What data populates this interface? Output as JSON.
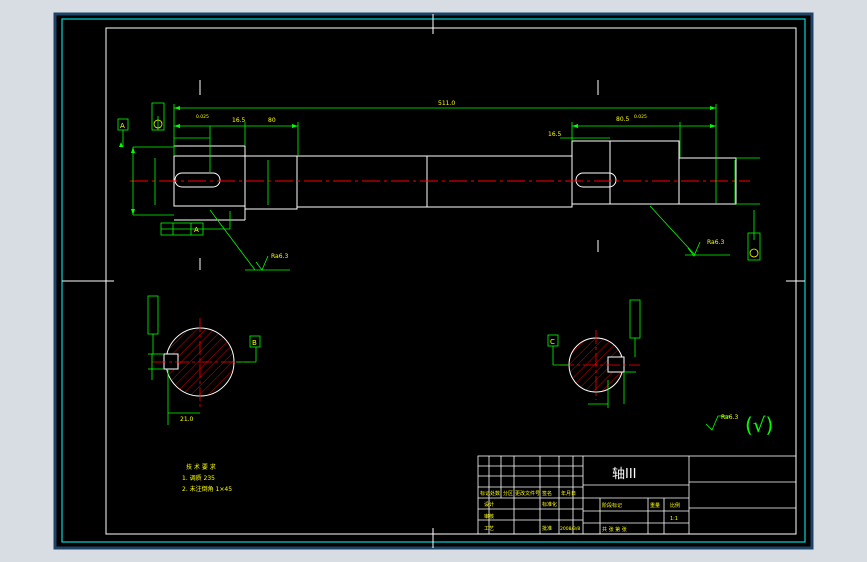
{
  "drawing": {
    "title": "轴III",
    "overall_length": "511.0",
    "technical_requirements": {
      "heading": "技 术 要 求",
      "item_1": "1. 调质 235",
      "item_2": "2. 未注倒角 1×45"
    },
    "general_roughness": "Ra6.3",
    "datum_letters": {
      "a": "A",
      "b": "B",
      "c": "C"
    },
    "dims": {
      "left_keyway": "80",
      "left_step": "16.5",
      "left_dia": "φ",
      "right_keyway": "16.5",
      "right_len": "80.5",
      "key_width": "21.0",
      "tolerance": "0.025"
    },
    "roughness_marks": {
      "left": "Ra6.3",
      "right": "Ra6.3"
    }
  },
  "title_block": {
    "name": "轴III",
    "row_labels": [
      "标记",
      "处数",
      "分区",
      "更改文件号",
      "签名",
      "年月日"
    ],
    "designer": "设计",
    "reviewer": "审核",
    "process": "工艺",
    "standard": "标准化",
    "approve": "批准",
    "date": "2008/3/8",
    "stage_label": "阶段标记",
    "weight": "重量",
    "scale": "比例",
    "scale_value": "1:1",
    "sheet": "共 张 第 张"
  },
  "colors": {
    "frame": "#00ffff",
    "outline": "#ffffff",
    "dimension": "#00ff00",
    "text": "#ffff00",
    "centerline": "#ff0000",
    "hatch": "#ff0000",
    "paper": "#000000",
    "border_bg": "#0a2b4a"
  }
}
